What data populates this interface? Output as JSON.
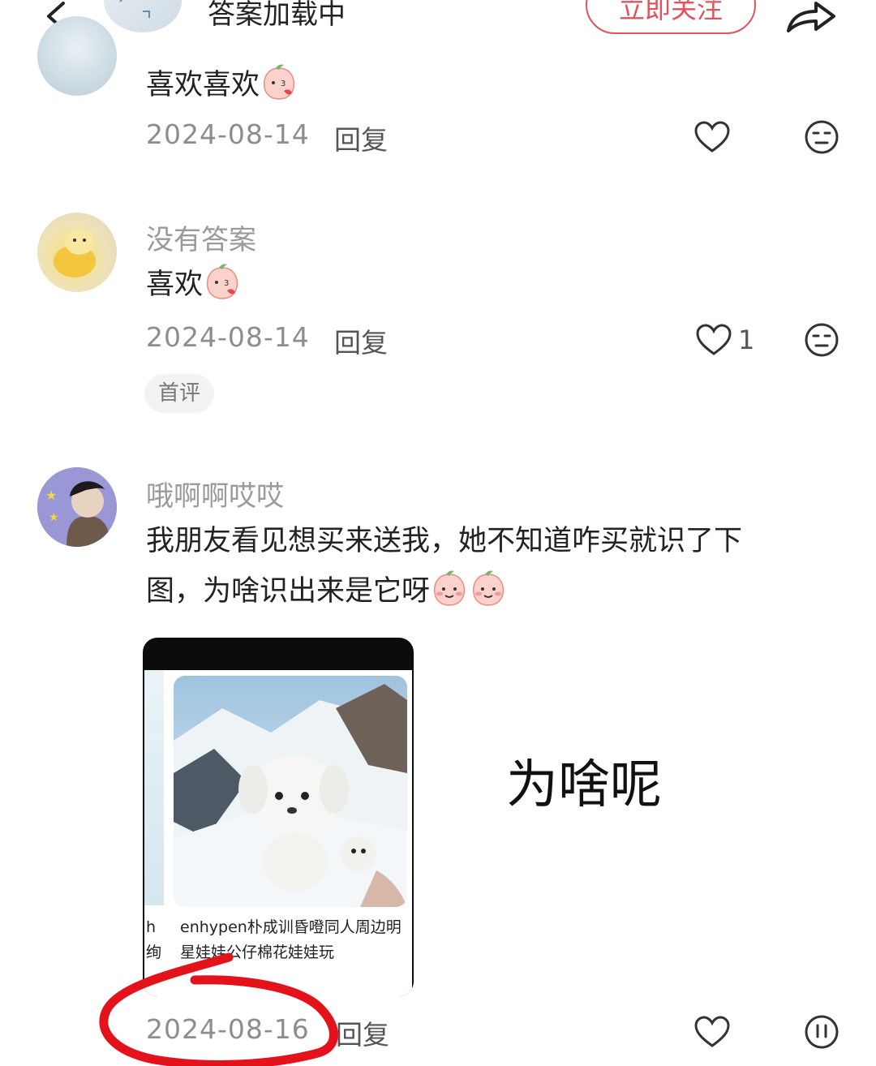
{
  "header": {
    "title": "答案加载中",
    "follow_label": "立即关注"
  },
  "comments": [
    {
      "text": "喜欢喜欢",
      "date": "2024-08-14",
      "reply_label": "回复"
    },
    {
      "username": "没有答案",
      "text": "喜欢",
      "date": "2024-08-14",
      "reply_label": "回复",
      "like_count": "1",
      "badge": "首评"
    },
    {
      "username": "哦啊啊哎哎",
      "text_line1": "我朋友看见想买来送我，她不知道咋买就识了下",
      "text_line2": "图，为啥识出来是它呀",
      "date": "2024-08-16",
      "reply_label": "回复",
      "image_caption": "enhypen朴成训昏噔同人周边明星娃娃公仔棉花娃娃玩",
      "image_caption_cut": "h 绚"
    }
  ],
  "overlay_text": "为啥呢",
  "colors": {
    "accent": "#e0535e",
    "annotation": "#e3121b",
    "muted": "#8d8d8d"
  }
}
